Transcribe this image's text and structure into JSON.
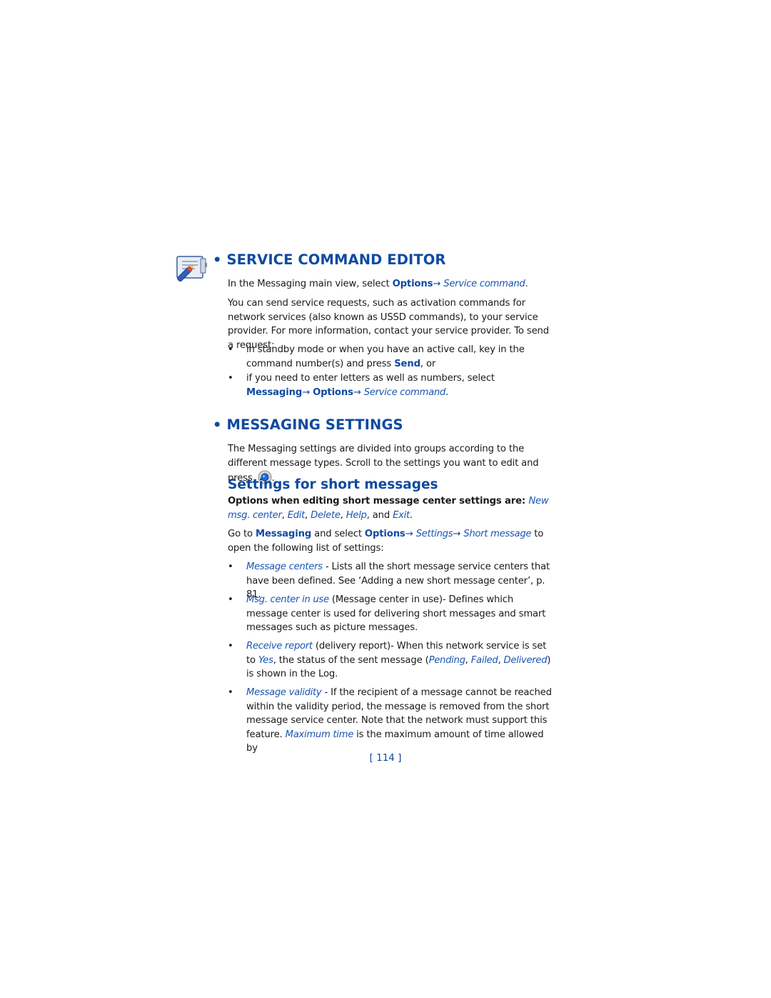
{
  "section1": {
    "icon": "service-command-editor-icon",
    "title": "• SERVICE COMMAND EDITOR",
    "intro": {
      "prefix": "In the Messaging main view, select ",
      "options": "Options",
      "arrow": "→ ",
      "service_command": "Service command",
      "suffix": "."
    },
    "body": "You can send service requests, such as activation commands for network services (also known as USSD commands), to your service provider. For more information, contact your service provider. To send a request:",
    "bullets": [
      {
        "marker": "•",
        "prefix": "in standby mode or when you have an active call, key in the command number(s) and press ",
        "send": "Send",
        "suffix": ", or"
      },
      {
        "marker": "•",
        "prefix": "if you need to enter letters as well as numbers, select ",
        "messaging": "Messaging",
        "arrow1": "→ ",
        "options": "Options",
        "arrow2": "→ ",
        "service_command": "Service command",
        "suffix": "."
      }
    ]
  },
  "section2": {
    "title": "• MESSAGING SETTINGS",
    "body_prefix": "The Messaging settings are divided into groups according to the different message types. Scroll to the settings you want to edit and press ",
    "nav_key_icon": "navigation-key-icon",
    "body_suffix": ".",
    "subsection": {
      "title": "Settings for short messages",
      "options_label": "Options when editing short message center settings are: ",
      "options": [
        "New msg. center",
        "Edit",
        "Delete",
        "Help",
        "Exit"
      ],
      "options_sep": [
        ", ",
        ", ",
        ", ",
        ", and "
      ],
      "options_end": ".",
      "goto": {
        "prefix": "Go to ",
        "messaging": "Messaging",
        "mid": " and select ",
        "options": "Options",
        "arrow1": "→ ",
        "settings": "Settings",
        "arrow2": "→ ",
        "short_message": "Short message",
        "suffix": " to open the following list of settings:"
      },
      "settings": [
        {
          "marker": "•",
          "name": "Message centers",
          "text": " - Lists all the short message service centers that have been defined. See ‘Adding a new short message center’, p. 81."
        },
        {
          "marker": "•",
          "name": "Msg. center in use",
          "text": " (Message center in use)- Defines which message center is used for delivering short messages and smart messages such as picture messages."
        },
        {
          "marker": "•",
          "name": "Receive report",
          "text1": " (delivery report)- When this network service is set to ",
          "yes": "Yes",
          "text2": ", the status of the sent message (",
          "pending": "Pending",
          "sep1": ", ",
          "failed": "Failed",
          "sep2": ", ",
          "delivered": "Delivered",
          "text3": ") is shown in the Log."
        },
        {
          "marker": "•",
          "name": "Message validity",
          "text1": " - If the recipient of a message cannot be reached within the validity period, the message is removed from the short message service center. Note that the network must support this feature. ",
          "max_time": "Maximum time",
          "text2": " is the maximum amount of time allowed by"
        }
      ]
    }
  },
  "footer": {
    "page_number": "[ 114 ]"
  },
  "colors": {
    "heading_blue": "#0f4aa0",
    "link_blue": "#1a55b0",
    "body_text": "#1a1a1a"
  }
}
